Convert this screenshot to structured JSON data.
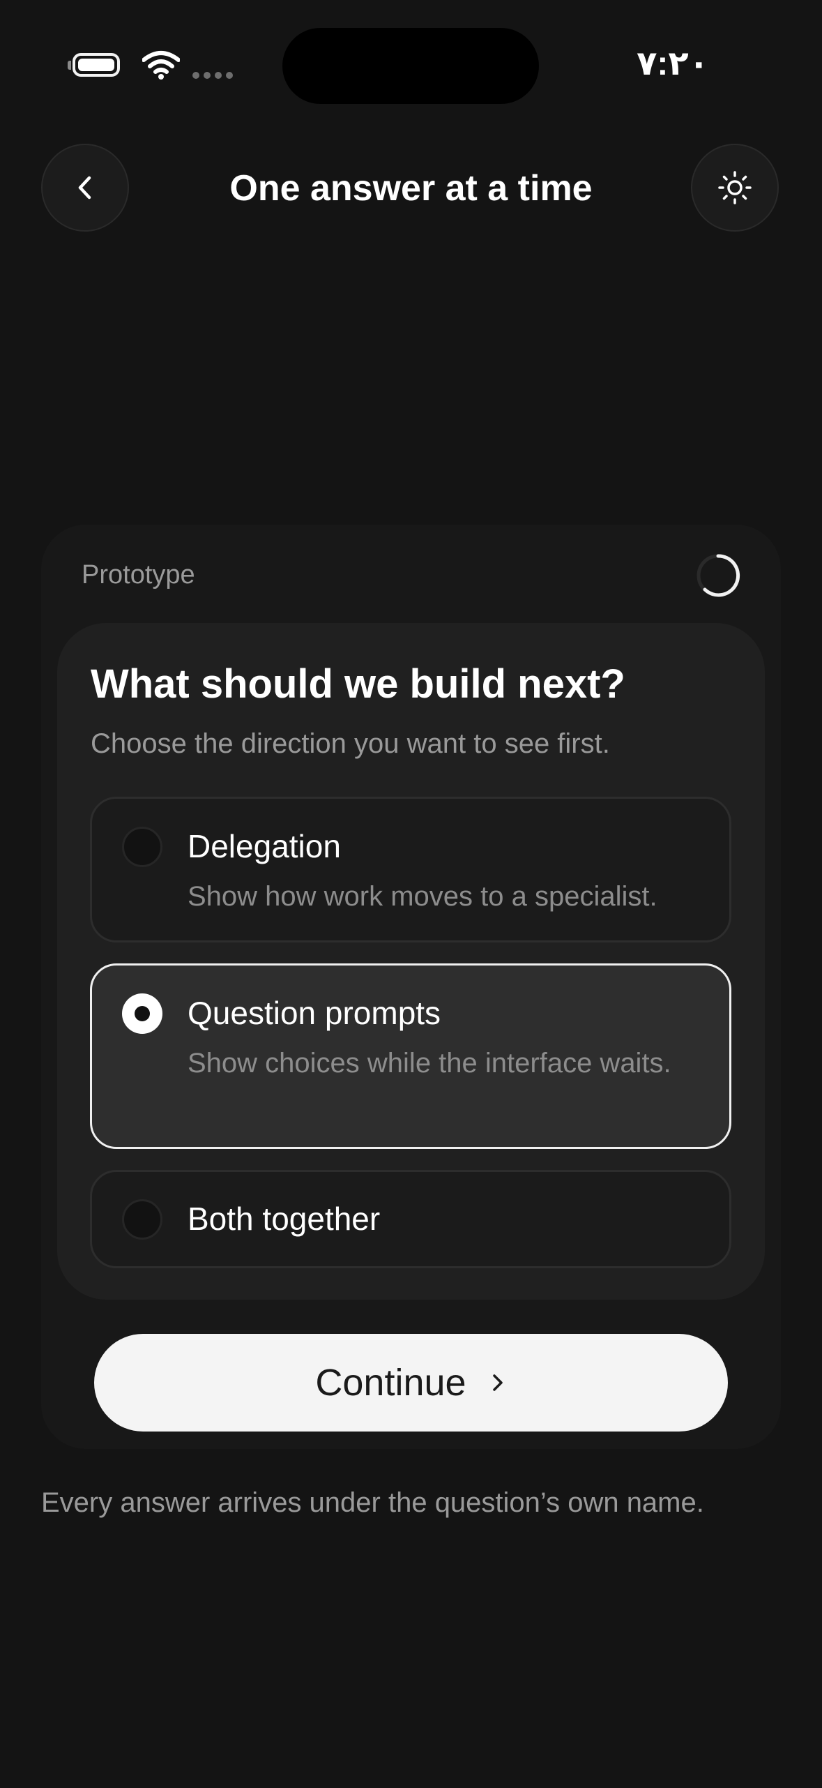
{
  "status_bar": {
    "time": "٧:٢٠"
  },
  "header": {
    "title": "One answer at a time"
  },
  "card": {
    "label": "Prototype",
    "question": "What should we build next?",
    "subtitle": "Choose the direction you want to see first.",
    "options": [
      {
        "label": "Delegation",
        "description": "Show how work moves to a specialist.",
        "selected": false
      },
      {
        "label": "Question prompts",
        "description": "Show choices while the interface waits.",
        "selected": true
      },
      {
        "label": "Both together",
        "description": "",
        "selected": false
      }
    ],
    "continue_label": "Continue"
  },
  "footer": {
    "note": "Every answer arrives under the question’s own name."
  },
  "colors": {
    "background": "#141414",
    "card": "#181818",
    "inner_card": "#202020",
    "selected_option": "#2e2e2e",
    "button": "#f4f4f4"
  },
  "icons": {
    "back": "chevron-left-icon",
    "theme": "sun-icon",
    "loading": "spinner-icon",
    "continue": "chevron-right-icon"
  }
}
